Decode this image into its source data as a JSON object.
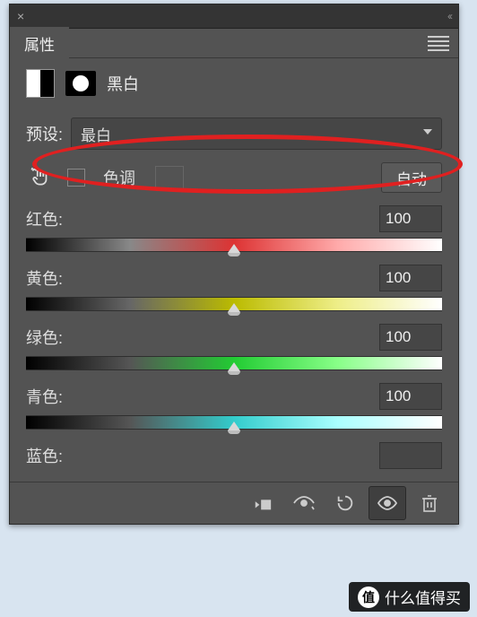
{
  "panel": {
    "tab": "属性",
    "title": "黑白",
    "close": "×",
    "collapse": "‹‹"
  },
  "preset": {
    "label": "预设:",
    "value": "最白"
  },
  "tint": {
    "label": "色调"
  },
  "auto": {
    "label": "自动"
  },
  "sliders": [
    {
      "label": "红色:",
      "value": "100",
      "track": "t-red"
    },
    {
      "label": "黄色:",
      "value": "100",
      "track": "t-yellow"
    },
    {
      "label": "绿色:",
      "value": "100",
      "track": "t-green"
    },
    {
      "label": "青色:",
      "value": "100",
      "track": "t-cyan"
    },
    {
      "label": "蓝色:",
      "value": "",
      "track": ""
    }
  ],
  "credit": "什么值得买"
}
